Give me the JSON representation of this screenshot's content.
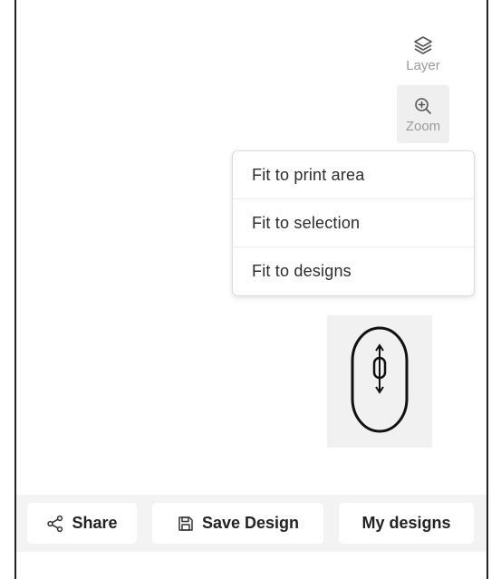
{
  "tools": {
    "layer_label": "Layer",
    "zoom_label": "Zoom",
    "layer_icon": "layers-icon",
    "zoom_icon": "zoom-in-icon"
  },
  "zoom_menu": {
    "items": [
      {
        "label": "Fit to print area"
      },
      {
        "label": "Fit to selection"
      },
      {
        "label": "Fit to designs"
      }
    ]
  },
  "mouse_hint": {
    "icon": "mouse-scroll-icon"
  },
  "actions": {
    "share_label": "Share",
    "save_label": "Save Design",
    "mydesigns_label": "My designs",
    "share_icon": "share-icon",
    "save_icon": "save-icon"
  },
  "colors": {
    "text": "#222222",
    "muted": "#9a9a9a",
    "bar": "#f3f3f3"
  }
}
